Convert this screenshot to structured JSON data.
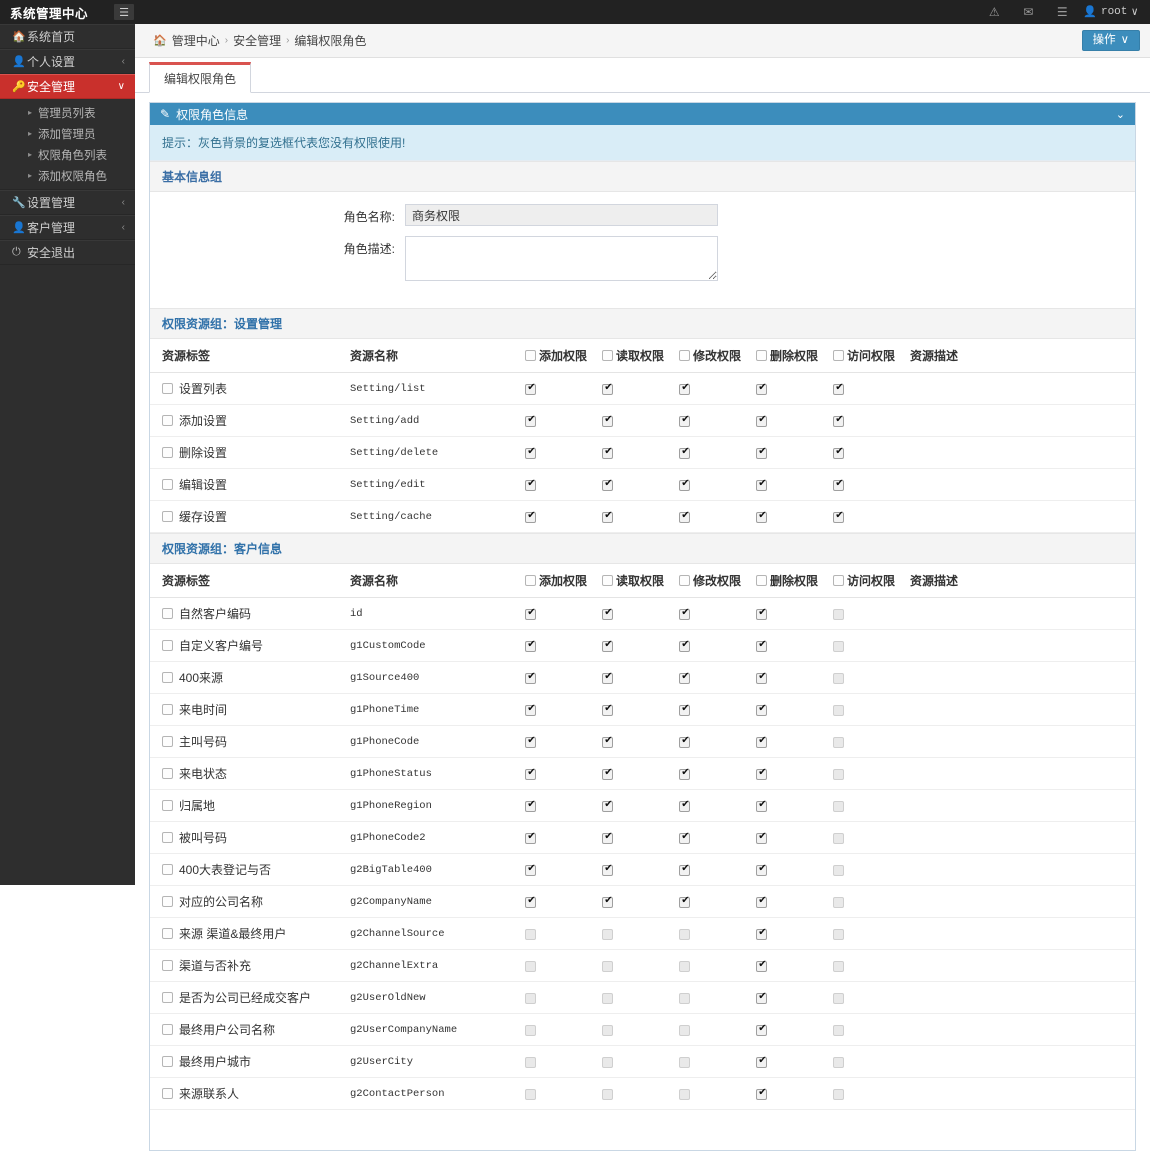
{
  "topbar": {
    "brand": "系统管理中心",
    "hamburger_icon": "hamburger-icon",
    "icons": [
      {
        "name": "warning-icon",
        "glyph": "⚠"
      },
      {
        "name": "envelope-icon",
        "glyph": "✉"
      },
      {
        "name": "tasks-icon",
        "glyph": "☰"
      }
    ],
    "user": {
      "icon": "user-icon",
      "name": "root",
      "caret": "∨"
    }
  },
  "sidebar": {
    "items": [
      {
        "label": "系统首页",
        "icon": "home-icon",
        "caret": "",
        "active": false
      },
      {
        "label": "个人设置",
        "icon": "user-icon",
        "caret": "‹",
        "active": false
      },
      {
        "label": "安全管理",
        "icon": "key-icon",
        "caret": "∨",
        "active": true
      },
      {
        "label": "设置管理",
        "icon": "wrench-icon",
        "caret": "‹",
        "active": false
      },
      {
        "label": "客户管理",
        "icon": "users-icon",
        "caret": "‹",
        "active": false
      },
      {
        "label": "安全退出",
        "icon": "power-icon",
        "caret": "",
        "active": false
      }
    ],
    "submenu": [
      {
        "label": "管理员列表"
      },
      {
        "label": "添加管理员"
      },
      {
        "label": "权限角色列表"
      },
      {
        "label": "添加权限角色"
      }
    ]
  },
  "breadcrumb": {
    "home_icon": "home-icon",
    "items": [
      "管理中心",
      "安全管理",
      "编辑权限角色"
    ],
    "separator": "›"
  },
  "action_button": {
    "label": "操作",
    "caret": "∨"
  },
  "tabs": [
    {
      "label": "编辑权限角色",
      "active": true
    }
  ],
  "panel": {
    "icon": "edit-icon",
    "title": "权限角色信息",
    "collapse_icon": "chevron-down-icon",
    "tip": "提示：灰色背景的复选框代表您没有权限使用!",
    "accent_color": "#3c8dbc"
  },
  "basic_group": {
    "title": "基本信息组",
    "fields": [
      {
        "label": "角色名称:",
        "type": "text",
        "value": "商务权限",
        "placeholder": ""
      },
      {
        "label": "角色描述:",
        "type": "textarea",
        "value": "",
        "placeholder": ""
      }
    ]
  },
  "tables": [
    {
      "group_title": "权限资源组：设置管理",
      "headers": [
        "资源标签",
        "资源名称",
        "添加权限",
        "读取权限",
        "修改权限",
        "删除权限",
        "访问权限",
        "资源描述"
      ],
      "header_checkbox_cols": [
        2,
        3,
        4,
        5,
        6
      ],
      "rows": [
        {
          "label": "设置列表",
          "name": "Setting/list",
          "perms": [
            "checked",
            "checked",
            "checked",
            "checked",
            "checked"
          ],
          "desc": ""
        },
        {
          "label": "添加设置",
          "name": "Setting/add",
          "perms": [
            "checked",
            "checked",
            "checked",
            "checked",
            "checked"
          ],
          "desc": ""
        },
        {
          "label": "删除设置",
          "name": "Setting/delete",
          "perms": [
            "checked",
            "checked",
            "checked",
            "checked",
            "checked"
          ],
          "desc": ""
        },
        {
          "label": "编辑设置",
          "name": "Setting/edit",
          "perms": [
            "checked",
            "checked",
            "checked",
            "checked",
            "checked"
          ],
          "desc": ""
        },
        {
          "label": "缓存设置",
          "name": "Setting/cache",
          "perms": [
            "checked",
            "checked",
            "checked",
            "checked",
            "checked"
          ],
          "desc": ""
        }
      ]
    },
    {
      "group_title": "权限资源组：客户信息",
      "headers": [
        "资源标签",
        "资源名称",
        "添加权限",
        "读取权限",
        "修改权限",
        "删除权限",
        "访问权限",
        "资源描述"
      ],
      "header_checkbox_cols": [
        2,
        3,
        4,
        5,
        6
      ],
      "rows": [
        {
          "label": "自然客户编码",
          "name": "id",
          "perms": [
            "checked",
            "checked",
            "checked",
            "checked",
            "disabled"
          ],
          "desc": ""
        },
        {
          "label": "自定义客户编号",
          "name": "g1CustomCode",
          "perms": [
            "checked",
            "checked",
            "checked",
            "checked",
            "disabled"
          ],
          "desc": ""
        },
        {
          "label": "400来源",
          "name": "g1Source400",
          "perms": [
            "checked",
            "checked",
            "checked",
            "checked",
            "disabled"
          ],
          "desc": ""
        },
        {
          "label": "来电时间",
          "name": "g1PhoneTime",
          "perms": [
            "checked",
            "checked",
            "checked",
            "checked",
            "disabled"
          ],
          "desc": ""
        },
        {
          "label": "主叫号码",
          "name": "g1PhoneCode",
          "perms": [
            "checked",
            "checked",
            "checked",
            "checked",
            "disabled"
          ],
          "desc": ""
        },
        {
          "label": "来电状态",
          "name": "g1PhoneStatus",
          "perms": [
            "checked",
            "checked",
            "checked",
            "checked",
            "disabled"
          ],
          "desc": ""
        },
        {
          "label": "归属地",
          "name": "g1PhoneRegion",
          "perms": [
            "checked",
            "checked",
            "checked",
            "checked",
            "disabled"
          ],
          "desc": ""
        },
        {
          "label": "被叫号码",
          "name": "g1PhoneCode2",
          "perms": [
            "checked",
            "checked",
            "checked",
            "checked",
            "disabled"
          ],
          "desc": ""
        },
        {
          "label": "400大表登记与否",
          "name": "g2BigTable400",
          "perms": [
            "checked",
            "checked",
            "checked",
            "checked",
            "disabled"
          ],
          "desc": ""
        },
        {
          "label": "对应的公司名称",
          "name": "g2CompanyName",
          "perms": [
            "checked",
            "checked",
            "checked",
            "checked",
            "disabled"
          ],
          "desc": ""
        },
        {
          "label": "来源 渠道&最终用户",
          "name": "g2ChannelSource",
          "perms": [
            "disabled",
            "disabled",
            "disabled",
            "checked",
            "disabled"
          ],
          "desc": ""
        },
        {
          "label": "渠道与否补充",
          "name": "g2ChannelExtra",
          "perms": [
            "disabled",
            "disabled",
            "disabled",
            "checked",
            "disabled"
          ],
          "desc": ""
        },
        {
          "label": "是否为公司已经成交客户",
          "name": "g2UserOldNew",
          "perms": [
            "disabled",
            "disabled",
            "disabled",
            "checked",
            "disabled"
          ],
          "desc": ""
        },
        {
          "label": "最终用户公司名称",
          "name": "g2UserCompanyName",
          "perms": [
            "disabled",
            "disabled",
            "disabled",
            "checked",
            "disabled"
          ],
          "desc": ""
        },
        {
          "label": "最终用户城市",
          "name": "g2UserCity",
          "perms": [
            "disabled",
            "disabled",
            "disabled",
            "checked",
            "disabled"
          ],
          "desc": ""
        },
        {
          "label": "来源联系人",
          "name": "g2ContactPerson",
          "perms": [
            "disabled",
            "disabled",
            "disabled",
            "checked",
            "disabled"
          ],
          "desc": ""
        }
      ]
    }
  ]
}
